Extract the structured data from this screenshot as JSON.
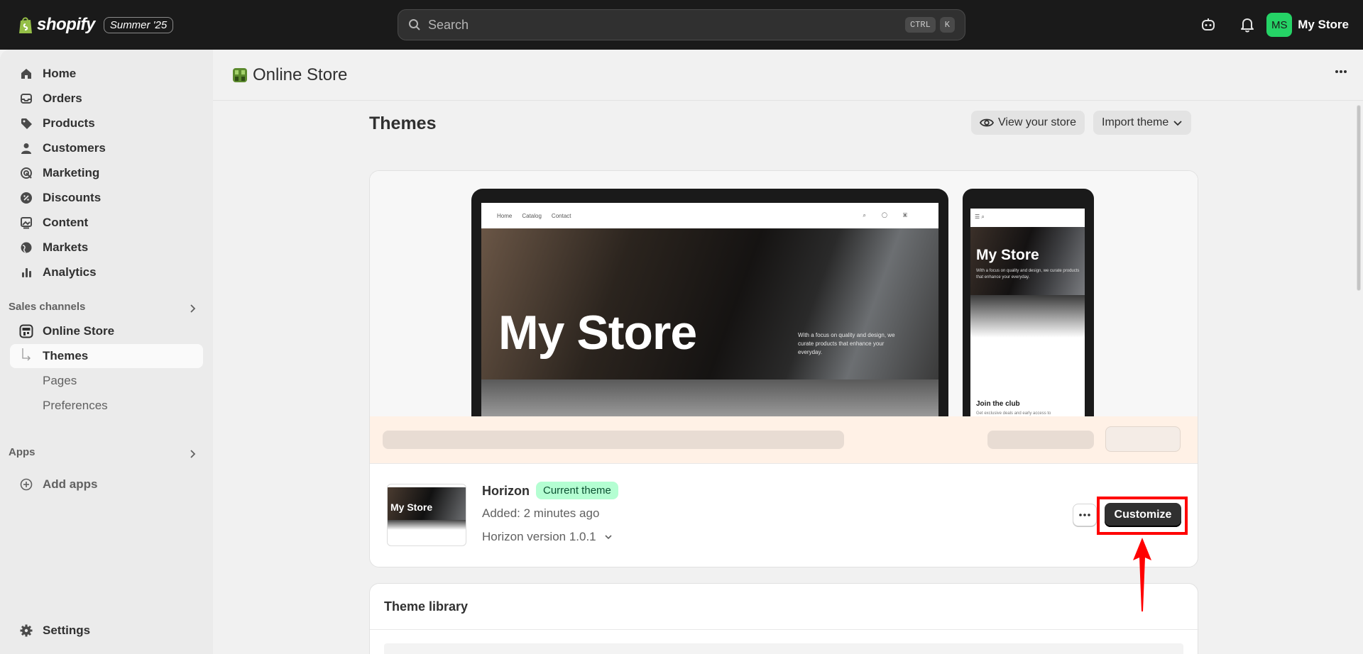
{
  "topbar": {
    "brand": "shopify",
    "edition_badge": "Summer '25",
    "search_placeholder": "Search",
    "shortcut_keys": [
      "CTRL",
      "K"
    ],
    "avatar_initials": "MS",
    "store_name": "My Store",
    "avatar_color": "#25d366"
  },
  "sidebar": {
    "items": [
      {
        "label": "Home",
        "icon": "home-icon"
      },
      {
        "label": "Orders",
        "icon": "inbox-icon"
      },
      {
        "label": "Products",
        "icon": "tag-icon"
      },
      {
        "label": "Customers",
        "icon": "person-icon"
      },
      {
        "label": "Marketing",
        "icon": "target-icon"
      },
      {
        "label": "Discounts",
        "icon": "discount-icon"
      },
      {
        "label": "Content",
        "icon": "image-icon"
      },
      {
        "label": "Markets",
        "icon": "globe-icon"
      },
      {
        "label": "Analytics",
        "icon": "bar-chart-icon"
      }
    ],
    "sales_channels_title": "Sales channels",
    "online_store": "Online Store",
    "sub_items": [
      "Themes",
      "Pages",
      "Preferences"
    ],
    "apps_title": "Apps",
    "add_apps": "Add apps",
    "settings": "Settings"
  },
  "main": {
    "header_title": "Online Store",
    "page_title": "Themes",
    "view_store": "View your store",
    "import_theme": "Import theme",
    "preview": {
      "nav_links": [
        "Home",
        "Catalog",
        "Contact"
      ],
      "hero_title": "My Store",
      "hero_tagline": "With a focus on quality and design, we curate products that enhance your everyday.",
      "phone_join_title": "Join the club",
      "phone_join_sub": "Get exclusive deals and early access to"
    },
    "theme": {
      "thumb_title": "My Store",
      "name": "Horizon",
      "badge": "Current theme",
      "added": "Added: 2 minutes ago",
      "version": "Horizon version 1.0.1",
      "customize": "Customize",
      "badge_color": "#b4fed2"
    },
    "library_title": "Theme library"
  },
  "annotation_color": "#ff0000"
}
